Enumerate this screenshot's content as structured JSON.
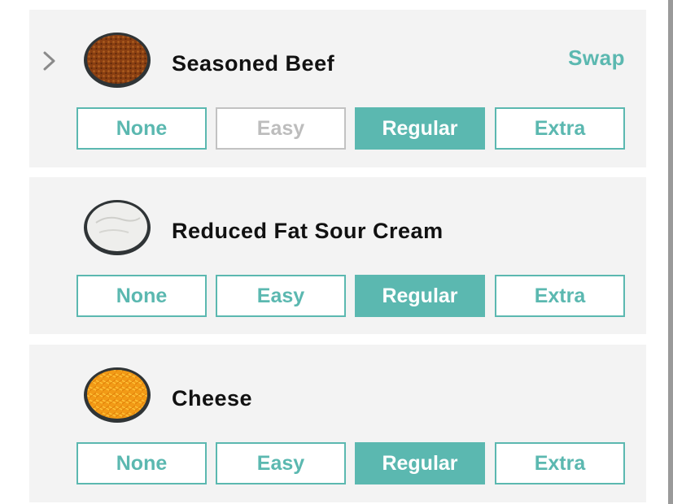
{
  "colors": {
    "accent": "#5bb8b0",
    "card_bg": "#f3f3f3",
    "disabled": "#c2c2c2"
  },
  "swap_label": "Swap",
  "items": [
    {
      "name": "Seasoned Beef",
      "icon": "seasoned-beef-bowl",
      "expand_icon": "chevron-right-icon",
      "options": [
        "None",
        "Easy",
        "Regular",
        "Extra"
      ],
      "selected": "Regular",
      "disabled": [
        "Easy"
      ]
    },
    {
      "name": "Reduced Fat Sour Cream",
      "icon": "sour-cream-bowl",
      "options": [
        "None",
        "Easy",
        "Regular",
        "Extra"
      ],
      "selected": "Regular",
      "disabled": []
    },
    {
      "name": "Cheese",
      "icon": "cheese-bowl",
      "options": [
        "None",
        "Easy",
        "Regular",
        "Extra"
      ],
      "selected": "Regular",
      "disabled": []
    }
  ]
}
